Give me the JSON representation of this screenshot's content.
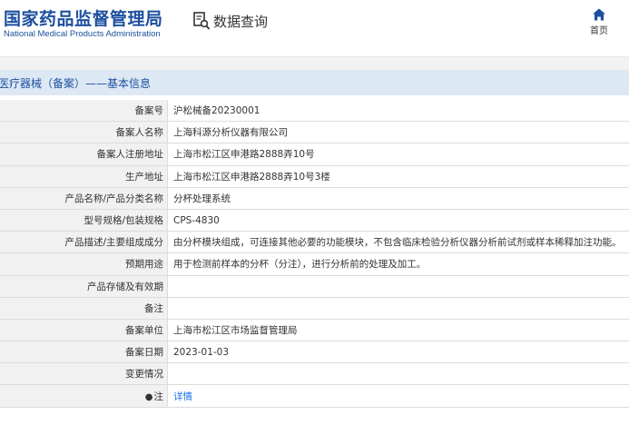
{
  "header": {
    "title_cn": "国家药品监督管理局",
    "title_en": "National Medical Products Administration",
    "query_label": "数据查询",
    "home_label": "首页"
  },
  "section_title": "医疗器械（备案）——基本信息",
  "rows": [
    {
      "label": "备案号",
      "value": "沪松械备20230001"
    },
    {
      "label": "备案人名称",
      "value": "上海科源分析仪器有限公司"
    },
    {
      "label": "备案人注册地址",
      "value": "上海市松江区申港路2888弄10号"
    },
    {
      "label": "生产地址",
      "value": "上海市松江区申港路2888弄10号3楼"
    },
    {
      "label": "产品名称/产品分类名称",
      "value": "分杯处理系统"
    },
    {
      "label": "型号规格/包装规格",
      "value": "CPS-4830"
    },
    {
      "label": "产品描述/主要组成成分",
      "value": "由分杯模块组成，可连接其他必要的功能模块，不包含临床检验分析仪器分析前试剂或样本稀释加注功能。"
    },
    {
      "label": "预期用途",
      "value": "用于检测前样本的分杯（分注），进行分析前的处理及加工。"
    },
    {
      "label": "产品存储及有效期",
      "value": ""
    },
    {
      "label": "备注",
      "value": ""
    },
    {
      "label": "备案单位",
      "value": "上海市松江区市场监督管理局"
    },
    {
      "label": "备案日期",
      "value": "2023-01-03"
    },
    {
      "label": "变更情况",
      "value": ""
    },
    {
      "label": "注",
      "value": "详情"
    }
  ],
  "colors": {
    "brand": "#1c4f9e",
    "section_bg": "#dde8f5",
    "label_bg": "#f1f1f1",
    "link": "#1a73e8"
  },
  "icons": {
    "query": "search-document-icon",
    "home": "home-icon",
    "note": "note-icon"
  }
}
